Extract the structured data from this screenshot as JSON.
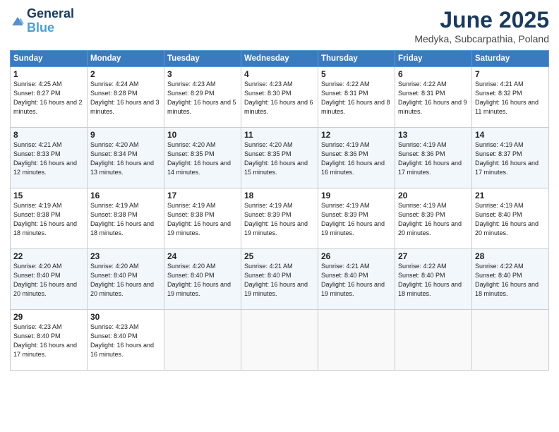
{
  "header": {
    "logo_line1": "General",
    "logo_line2": "Blue",
    "month": "June 2025",
    "location": "Medyka, Subcarpathia, Poland"
  },
  "days_of_week": [
    "Sunday",
    "Monday",
    "Tuesday",
    "Wednesday",
    "Thursday",
    "Friday",
    "Saturday"
  ],
  "weeks": [
    [
      {
        "day": "1",
        "rise": "4:25 AM",
        "set": "8:27 PM",
        "daylight": "16 hours and 2 minutes."
      },
      {
        "day": "2",
        "rise": "4:24 AM",
        "set": "8:28 PM",
        "daylight": "16 hours and 3 minutes."
      },
      {
        "day": "3",
        "rise": "4:23 AM",
        "set": "8:29 PM",
        "daylight": "16 hours and 5 minutes."
      },
      {
        "day": "4",
        "rise": "4:23 AM",
        "set": "8:30 PM",
        "daylight": "16 hours and 6 minutes."
      },
      {
        "day": "5",
        "rise": "4:22 AM",
        "set": "8:31 PM",
        "daylight": "16 hours and 8 minutes."
      },
      {
        "day": "6",
        "rise": "4:22 AM",
        "set": "8:31 PM",
        "daylight": "16 hours and 9 minutes."
      },
      {
        "day": "7",
        "rise": "4:21 AM",
        "set": "8:32 PM",
        "daylight": "16 hours and 11 minutes."
      }
    ],
    [
      {
        "day": "8",
        "rise": "4:21 AM",
        "set": "8:33 PM",
        "daylight": "16 hours and 12 minutes."
      },
      {
        "day": "9",
        "rise": "4:20 AM",
        "set": "8:34 PM",
        "daylight": "16 hours and 13 minutes."
      },
      {
        "day": "10",
        "rise": "4:20 AM",
        "set": "8:35 PM",
        "daylight": "16 hours and 14 minutes."
      },
      {
        "day": "11",
        "rise": "4:20 AM",
        "set": "8:35 PM",
        "daylight": "16 hours and 15 minutes."
      },
      {
        "day": "12",
        "rise": "4:19 AM",
        "set": "8:36 PM",
        "daylight": "16 hours and 16 minutes."
      },
      {
        "day": "13",
        "rise": "4:19 AM",
        "set": "8:36 PM",
        "daylight": "16 hours and 17 minutes."
      },
      {
        "day": "14",
        "rise": "4:19 AM",
        "set": "8:37 PM",
        "daylight": "16 hours and 17 minutes."
      }
    ],
    [
      {
        "day": "15",
        "rise": "4:19 AM",
        "set": "8:38 PM",
        "daylight": "16 hours and 18 minutes."
      },
      {
        "day": "16",
        "rise": "4:19 AM",
        "set": "8:38 PM",
        "daylight": "16 hours and 18 minutes."
      },
      {
        "day": "17",
        "rise": "4:19 AM",
        "set": "8:38 PM",
        "daylight": "16 hours and 19 minutes."
      },
      {
        "day": "18",
        "rise": "4:19 AM",
        "set": "8:39 PM",
        "daylight": "16 hours and 19 minutes."
      },
      {
        "day": "19",
        "rise": "4:19 AM",
        "set": "8:39 PM",
        "daylight": "16 hours and 19 minutes."
      },
      {
        "day": "20",
        "rise": "4:19 AM",
        "set": "8:39 PM",
        "daylight": "16 hours and 20 minutes."
      },
      {
        "day": "21",
        "rise": "4:19 AM",
        "set": "8:40 PM",
        "daylight": "16 hours and 20 minutes."
      }
    ],
    [
      {
        "day": "22",
        "rise": "4:20 AM",
        "set": "8:40 PM",
        "daylight": "16 hours and 20 minutes."
      },
      {
        "day": "23",
        "rise": "4:20 AM",
        "set": "8:40 PM",
        "daylight": "16 hours and 20 minutes."
      },
      {
        "day": "24",
        "rise": "4:20 AM",
        "set": "8:40 PM",
        "daylight": "16 hours and 19 minutes."
      },
      {
        "day": "25",
        "rise": "4:21 AM",
        "set": "8:40 PM",
        "daylight": "16 hours and 19 minutes."
      },
      {
        "day": "26",
        "rise": "4:21 AM",
        "set": "8:40 PM",
        "daylight": "16 hours and 19 minutes."
      },
      {
        "day": "27",
        "rise": "4:22 AM",
        "set": "8:40 PM",
        "daylight": "16 hours and 18 minutes."
      },
      {
        "day": "28",
        "rise": "4:22 AM",
        "set": "8:40 PM",
        "daylight": "16 hours and 18 minutes."
      }
    ],
    [
      {
        "day": "29",
        "rise": "4:23 AM",
        "set": "8:40 PM",
        "daylight": "16 hours and 17 minutes."
      },
      {
        "day": "30",
        "rise": "4:23 AM",
        "set": "8:40 PM",
        "daylight": "16 hours and 16 minutes."
      },
      null,
      null,
      null,
      null,
      null
    ]
  ],
  "labels": {
    "sunrise": "Sunrise:",
    "sunset": "Sunset:",
    "daylight": "Daylight:"
  }
}
